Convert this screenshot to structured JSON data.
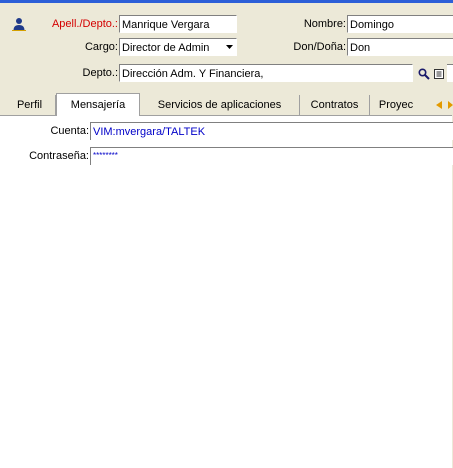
{
  "header": {
    "apell_label": "Apell./Depto.:",
    "apell_value": "Manrique Vergara",
    "nombre_label": "Nombre:",
    "nombre_value": "Domingo",
    "cargo_label": "Cargo:",
    "cargo_value": "Director de Admin",
    "don_label": "Don/Doña:",
    "don_value": "Don",
    "depto_label": "Depto.:",
    "depto_value": "Dirección Adm. Y Financiera,"
  },
  "tabs": [
    {
      "label": "Perfil"
    },
    {
      "label": "Mensajería"
    },
    {
      "label": "Servicios de aplicaciones"
    },
    {
      "label": "Contratos"
    },
    {
      "label": "Proyec"
    }
  ],
  "mensajeria": {
    "cuenta_label": "Cuenta:",
    "cuenta_value": "VIM:mvergara/TALTEK",
    "contrasena_label": "Contraseña:",
    "contrasena_value": "********"
  },
  "colors": {
    "accent": "#2c5fd8",
    "required_label": "#d40000",
    "link_value": "#0000c8",
    "window_bg": "#ece9d8"
  },
  "icons": {
    "person": "person-icon",
    "dropdown": "chevron-down-icon",
    "zoom": "magnifier-icon",
    "detail": "detail-icon",
    "tabs_prev": "arrow-left-icon",
    "tabs_next": "arrow-right-icon"
  }
}
